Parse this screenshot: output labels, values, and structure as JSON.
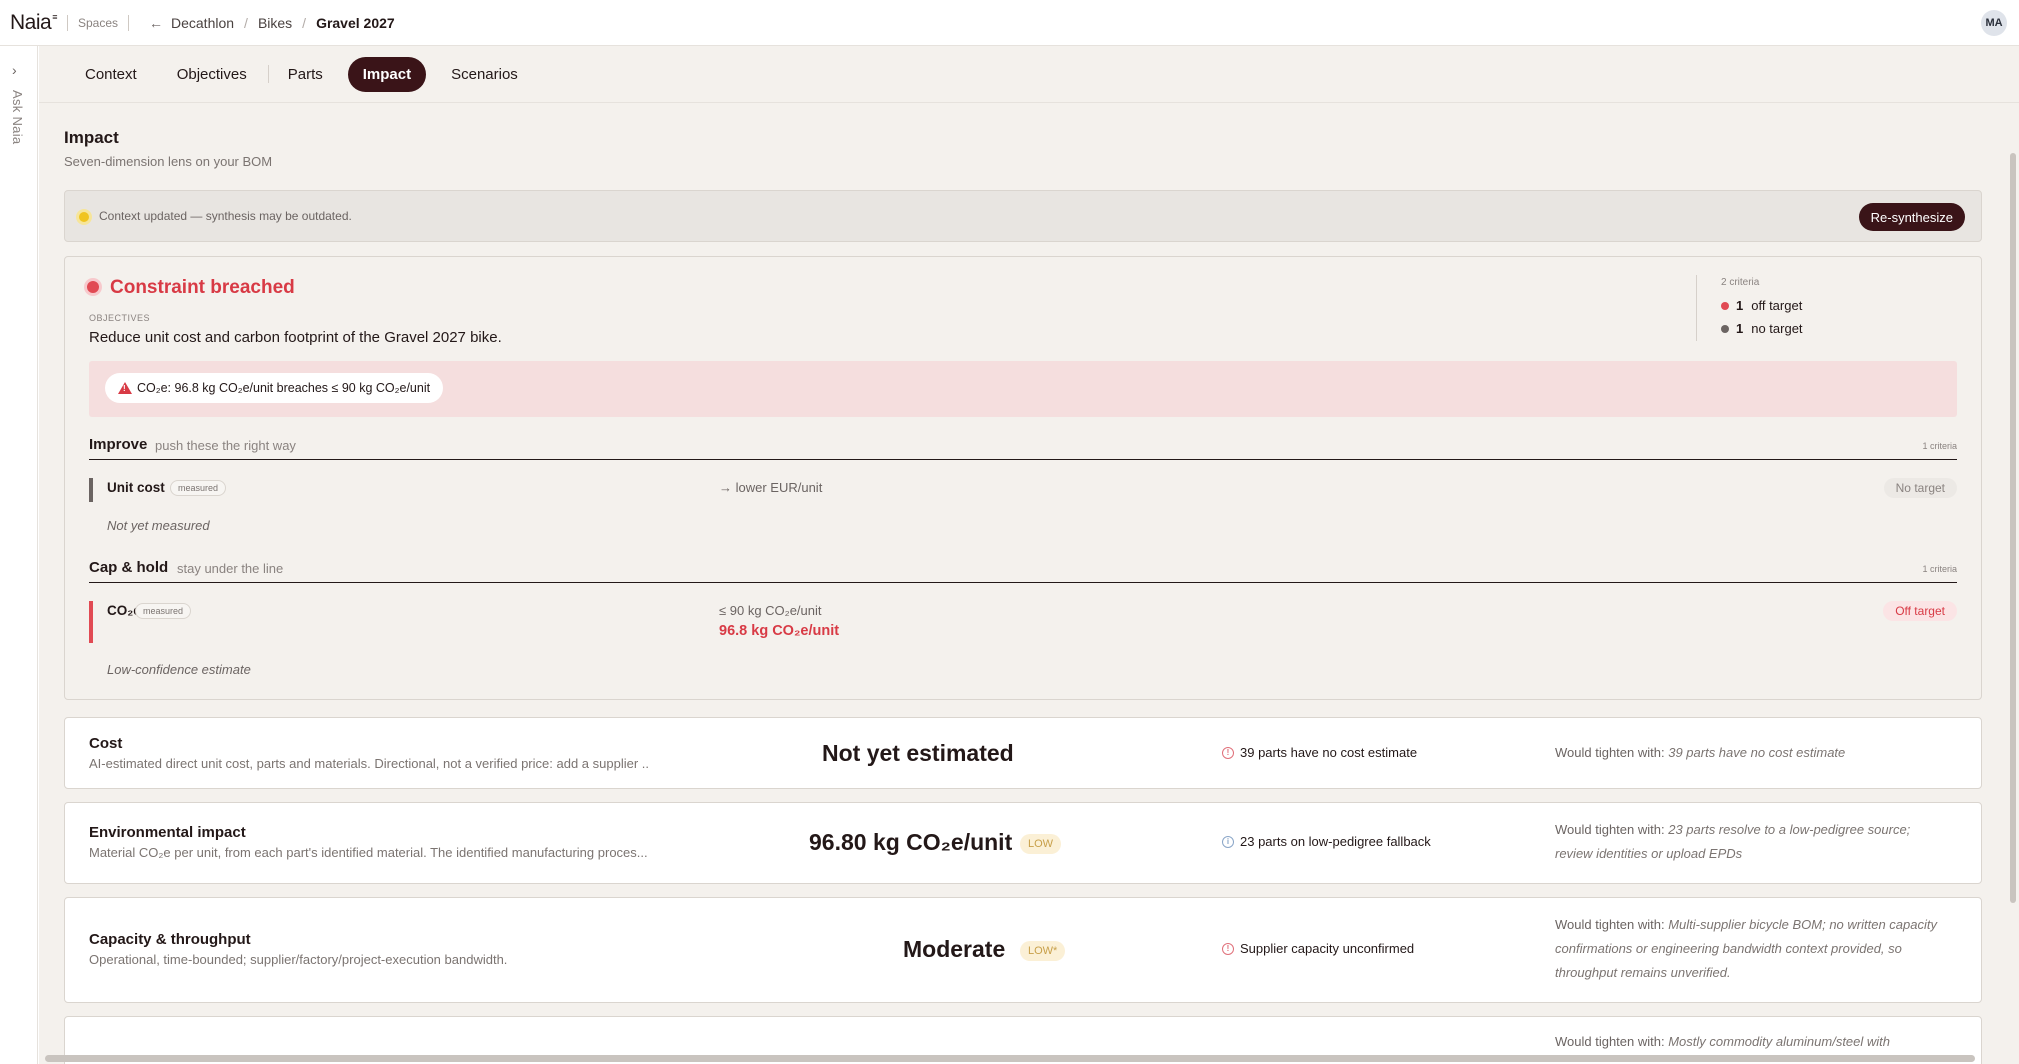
{
  "header": {
    "logo": "Naia",
    "logo_mark": "≡",
    "spaces": "Spaces",
    "breadcrumb": [
      "Decathlon",
      "Bikes"
    ],
    "current": "Gravel 2027",
    "avatar": "MA"
  },
  "rail": {
    "ask": "Ask Naia"
  },
  "tabs": [
    {
      "label": "Context",
      "active": false
    },
    {
      "label": "Objectives",
      "active": false
    },
    {
      "label": "Parts",
      "active": false
    },
    {
      "label": "Impact",
      "active": true
    },
    {
      "label": "Scenarios",
      "active": false
    }
  ],
  "page": {
    "title": "Impact",
    "subtitle": "Seven-dimension lens on your BOM"
  },
  "notice": {
    "text": "Context updated — synthesis may be outdated.",
    "button": "Re-synthesize"
  },
  "breach": {
    "title": "Constraint breached",
    "objectives_label": "OBJECTIVES",
    "objectives_text": "Reduce unit cost and carbon footprint of the Gravel 2027 bike.",
    "criteria_count": "2 criteria",
    "summary": [
      {
        "num": "1",
        "label": "off target",
        "color": "#e14a53"
      },
      {
        "num": "1",
        "label": "no target",
        "color": "#6b6462"
      }
    ],
    "warning": "CO₂e: 96.8 kg CO₂e/unit breaches ≤ 90 kg CO₂e/unit"
  },
  "improve": {
    "title": "Improve",
    "sub": "push these the right way",
    "count": "1 criteria",
    "item": {
      "name": "Unit cost",
      "tag": "measured",
      "target": "→ lower EUR/unit",
      "status": "No target",
      "note": "Not yet measured"
    }
  },
  "cap": {
    "title": "Cap & hold",
    "sub": "stay under the line",
    "count": "1 criteria",
    "item": {
      "name": "CO₂e",
      "tag": "measured",
      "target": "≤ 90 kg CO₂e/unit",
      "value": "96.8 kg CO₂e/unit",
      "status": "Off target",
      "note": "Low-confidence estimate"
    }
  },
  "dimensions": [
    {
      "name": "Cost",
      "desc": "AI-estimated direct unit cost, parts and materials. Directional, not a verified price: add a supplier ...",
      "value": "Not yet estimated",
      "confidence": "",
      "flag": "39 parts have no cost estimate",
      "flag_color": "#e0707a",
      "tighten_prefix": "Would tighten with: ",
      "tighten": "39 parts have no cost estimate"
    },
    {
      "name": "Environmental impact",
      "desc": "Material CO₂e per unit, from each part's identified material. The identified manufacturing proces...",
      "value": "96.80 kg CO₂e/unit",
      "confidence": "LOW",
      "flag": "23 parts on low-pedigree fallback",
      "flag_color": "#8aa6c8",
      "tighten_prefix": "Would tighten with: ",
      "tighten": "23 parts resolve to a low-pedigree source; review identities or upload EPDs"
    },
    {
      "name": "Capacity & throughput",
      "desc": "Operational, time-bounded; supplier/factory/project-execution bandwidth.",
      "value": "Moderate",
      "confidence": "LOW*",
      "flag": "Supplier capacity unconfirmed",
      "flag_color": "#e0707a",
      "tighten_prefix": "Would tighten with: ",
      "tighten": "Multi-supplier bicycle BOM; no written capacity confirmations or engineering bandwidth context provided, so throughput remains unverified."
    },
    {
      "name": "",
      "desc": "",
      "value": "",
      "confidence": "",
      "flag": "",
      "flag_color": "#e0707a",
      "tighten_prefix": "Would tighten with: ",
      "tighten": "Mostly commodity aluminum/steel with"
    }
  ],
  "colors": {
    "accent": "#3a1418",
    "danger": "#d83a45",
    "warning": "#f0c420",
    "background": "#f4f1ed"
  }
}
